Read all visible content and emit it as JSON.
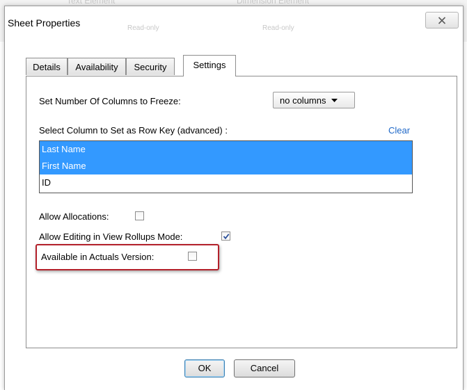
{
  "background": {
    "ghost_left": "Text Element",
    "ghost_right": "Dimension Element",
    "ghost_left_sub": "Read-only",
    "ghost_right_sub": "Read-only"
  },
  "dialog": {
    "title": "Sheet Properties",
    "close_icon": "close-icon"
  },
  "tabs": [
    {
      "label": "Details",
      "active": false
    },
    {
      "label": "Availability",
      "active": false
    },
    {
      "label": "Security",
      "active": false
    },
    {
      "label": "Settings",
      "active": true
    }
  ],
  "settings": {
    "freeze_label": "Set Number Of Columns to Freeze:",
    "freeze_value": "no columns",
    "row_key_label": "Select Column to Set as Row Key (advanced) :",
    "clear_label": "Clear",
    "columns": [
      {
        "label": "Last Name",
        "selected": true
      },
      {
        "label": "First Name",
        "selected": true
      },
      {
        "label": "ID",
        "selected": false
      }
    ],
    "allow_allocations_label": "Allow Allocations:",
    "allow_allocations_checked": false,
    "allow_editing_label": "Allow Editing in View Rollups Mode:",
    "allow_editing_checked": true,
    "actuals_label": "Available in Actuals Version:",
    "actuals_checked": false
  },
  "buttons": {
    "ok": "OK",
    "cancel": "Cancel"
  },
  "colors": {
    "selection": "#3399ff",
    "link": "#1f68c8",
    "highlight": "#b3202a"
  }
}
